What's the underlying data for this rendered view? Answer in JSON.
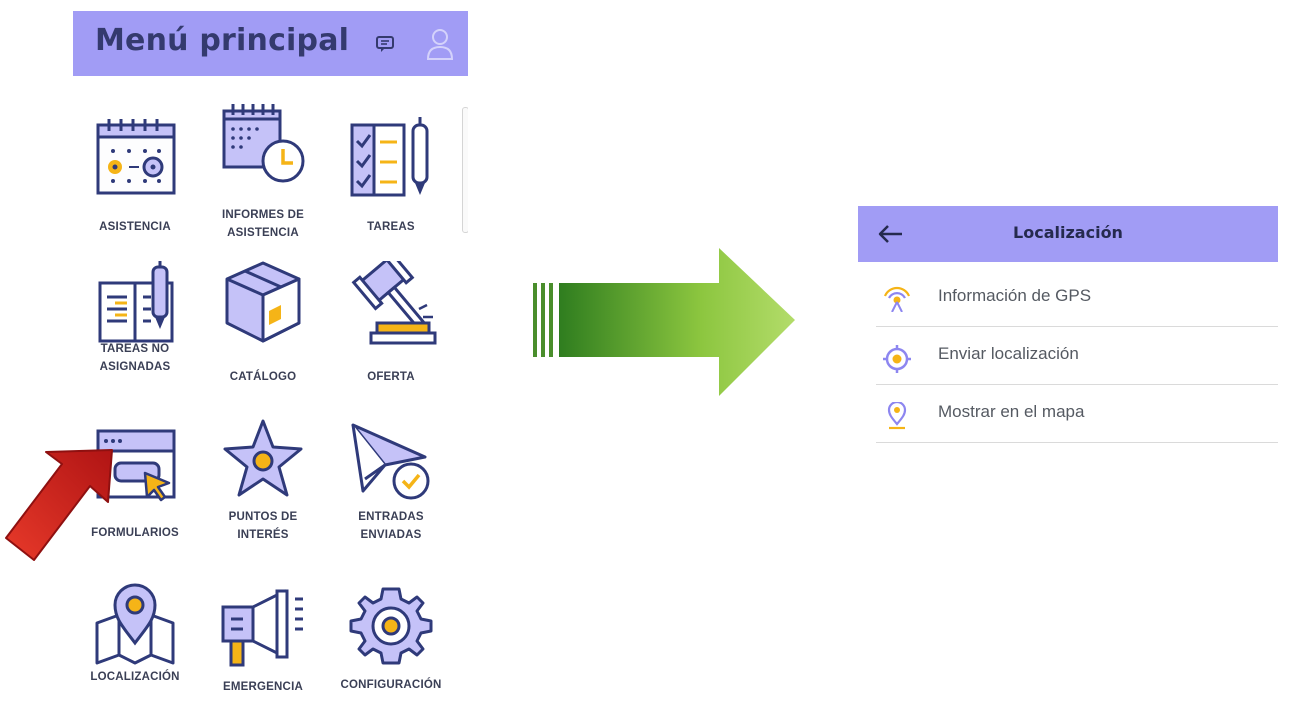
{
  "menu": {
    "title": "Menú principal",
    "tiles": [
      {
        "label_1": "ASISTENCIA",
        "label_2": ""
      },
      {
        "label_1": "INFORMES DE",
        "label_2": "ASISTENCIA"
      },
      {
        "label_1": "TAREAS",
        "label_2": ""
      },
      {
        "label_1": "TAREAS NO",
        "label_2": "ASIGNADAS"
      },
      {
        "label_1": "CATÁLOGO",
        "label_2": ""
      },
      {
        "label_1": "OFERTA",
        "label_2": ""
      },
      {
        "label_1": "FORMULARIOS",
        "label_2": ""
      },
      {
        "label_1": "PUNTOS DE",
        "label_2": "INTERÉS"
      },
      {
        "label_1": "ENTRADAS",
        "label_2": "ENVIADAS"
      },
      {
        "label_1": "LOCALIZACIÓN",
        "label_2": ""
      },
      {
        "label_1": "EMERGENCIA",
        "label_2": ""
      },
      {
        "label_1": "CONFIGURACIÓN",
        "label_2": ""
      }
    ]
  },
  "localization": {
    "title": "Localización",
    "items": [
      {
        "label": "Información de GPS",
        "icon": "gps-signal-icon"
      },
      {
        "label": "Enviar localización",
        "icon": "target-icon"
      },
      {
        "label": "Mostrar en el mapa",
        "icon": "map-pin-icon"
      }
    ]
  },
  "colors": {
    "header": "#a19cf5",
    "icon_stroke": "#2f3a7a",
    "icon_fill": "#c5c2f8",
    "accent": "#f5b417",
    "arrow_green": "#8cc63f",
    "pointer_red": "#d42020"
  }
}
